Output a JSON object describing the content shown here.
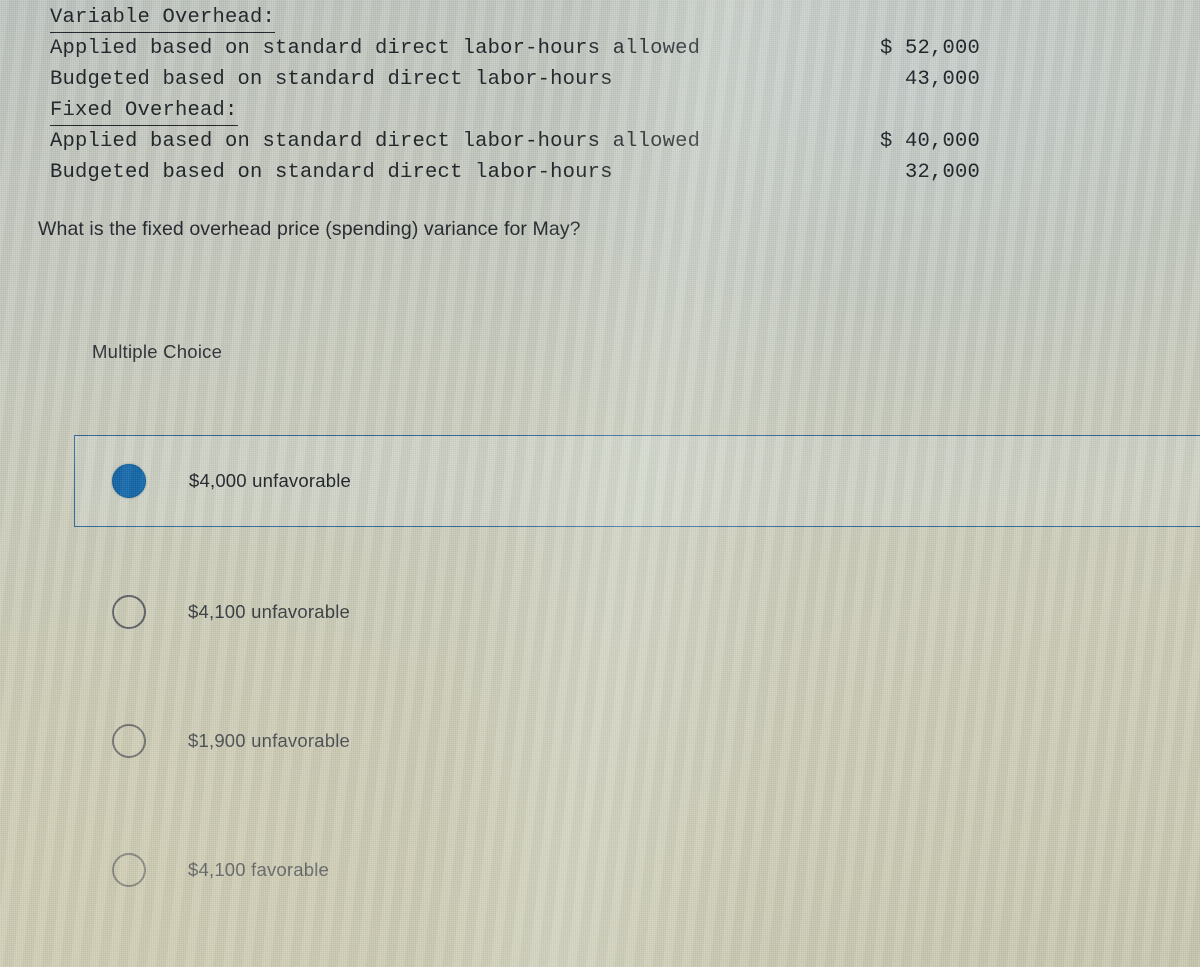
{
  "data_table": {
    "rows": [
      {
        "label": "Variable Overhead:",
        "amount": "",
        "heading": true
      },
      {
        "label": "Applied based on standard direct labor-hours allowed",
        "amount": "$ 52,000",
        "heading": false
      },
      {
        "label": "Budgeted based on standard direct labor-hours",
        "amount": "43,000",
        "heading": false
      },
      {
        "label": "Fixed Overhead:",
        "amount": "",
        "heading": true
      },
      {
        "label": "Applied based on standard direct labor-hours allowed",
        "amount": "$ 40,000",
        "heading": false
      },
      {
        "label": "Budgeted based on standard direct labor-hours",
        "amount": "32,000",
        "heading": false
      }
    ]
  },
  "question": {
    "text": "What is the fixed overhead price (spending) variance for May?",
    "type_label": "Multiple Choice"
  },
  "options": [
    {
      "label": "$4,000 unfavorable",
      "selected": true
    },
    {
      "label": "$4,100 unfavorable",
      "selected": false
    },
    {
      "label": "$1,900 unfavorable",
      "selected": false
    },
    {
      "label": "$4,100 favorable",
      "selected": false
    }
  ],
  "colors": {
    "selected_radio_fill": "#1566a8",
    "selection_border": "#2f6496",
    "unselected_radio_border": "#4c5158",
    "text": "#1b1f24",
    "background_cool": "#bcc2be",
    "background_warm": "#c6c5ae"
  }
}
